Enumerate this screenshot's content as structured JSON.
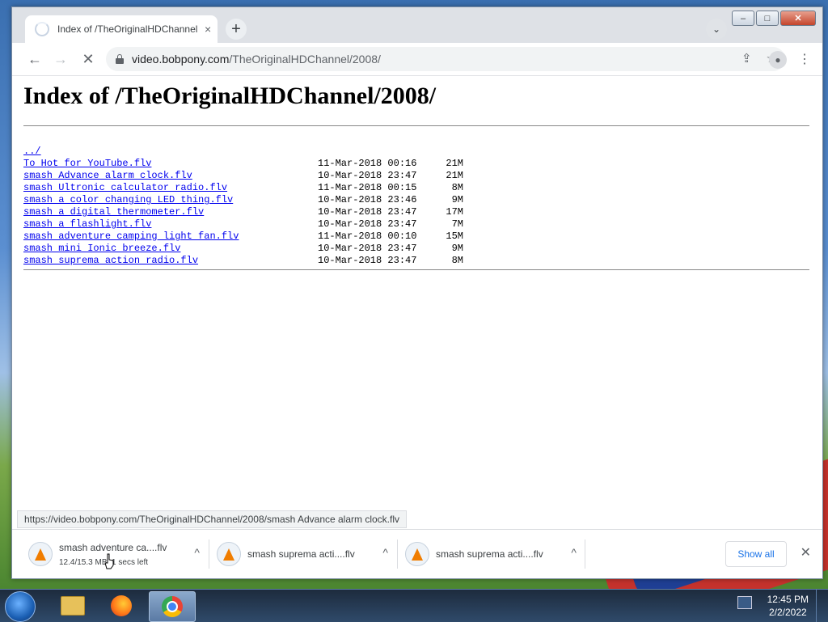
{
  "browser": {
    "tab_title": "Index of /TheOriginalHDChannel",
    "tab_close": "×",
    "new_tab": "+",
    "tab_search": "⌄",
    "url_host": "video.bobpony.com",
    "url_path": "/TheOriginalHDChannel/2008/",
    "window_controls": {
      "minimize": "–",
      "maximize": "□",
      "close": "✕"
    }
  },
  "page": {
    "heading": "Index of /TheOriginalHDChannel/2008/",
    "parent_link": "../",
    "files": [
      {
        "name": "To Hot for YouTube.flv",
        "date": "11-Mar-2018 00:16",
        "size": "21M"
      },
      {
        "name": "smash Advance alarm clock.flv",
        "date": "10-Mar-2018 23:47",
        "size": "21M"
      },
      {
        "name": "smash Ultronic calculator radio.flv",
        "date": "11-Mar-2018 00:15",
        "size": "8M"
      },
      {
        "name": "smash a color changing LED thing.flv",
        "date": "10-Mar-2018 23:46",
        "size": "9M"
      },
      {
        "name": "smash a digital thermometer.flv",
        "date": "10-Mar-2018 23:47",
        "size": "17M"
      },
      {
        "name": "smash a flashlight.flv",
        "date": "10-Mar-2018 23:47",
        "size": "7M"
      },
      {
        "name": "smash adventure camping light fan.flv",
        "date": "11-Mar-2018 00:10",
        "size": "15M"
      },
      {
        "name": "smash mini Ionic breeze.flv",
        "date": "10-Mar-2018 23:47",
        "size": "9M"
      },
      {
        "name": "smash suprema action radio.flv",
        "date": "10-Mar-2018 23:47",
        "size": "8M"
      }
    ]
  },
  "status_url": "https://video.bobpony.com/TheOriginalHDChannel/2008/smash Advance alarm clock.flv",
  "downloads": {
    "items": [
      {
        "name": "smash adventure ca....flv",
        "progress": "12.4/15.3 MB, 1 secs left"
      },
      {
        "name": "smash suprema acti....flv",
        "progress": ""
      },
      {
        "name": "smash suprema acti....flv",
        "progress": ""
      }
    ],
    "show_all": "Show all",
    "close": "✕"
  },
  "taskbar": {
    "time": "12:45 PM",
    "date": "2/2/2022"
  }
}
